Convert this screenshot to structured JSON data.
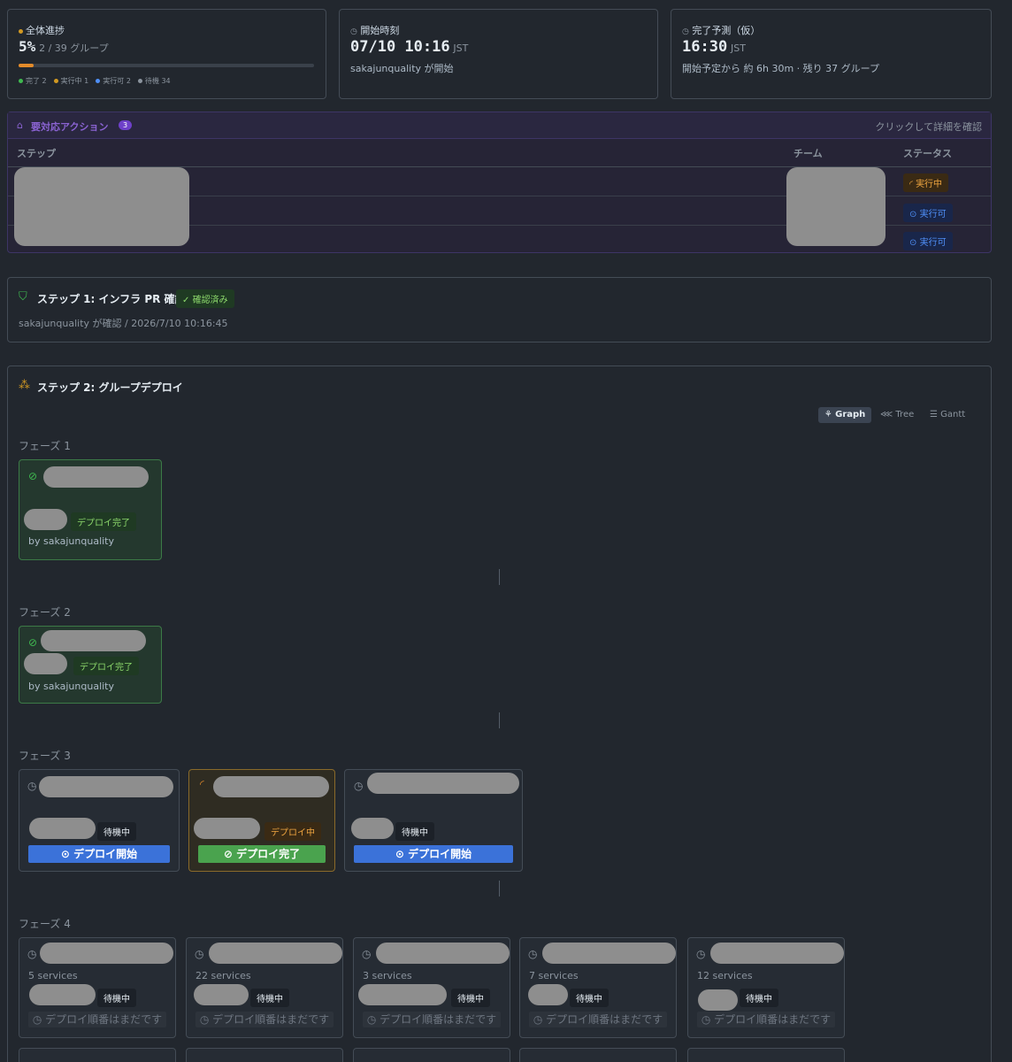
{
  "summary": {
    "progress": {
      "label": "全体進捗",
      "percent": "5%",
      "detail": "2 / 39 グループ",
      "fraction": 0.05,
      "legend": [
        {
          "label": "完了 2",
          "color": "#3fb950"
        },
        {
          "label": "実行中 1",
          "color": "#d29922"
        },
        {
          "label": "実行可 2",
          "color": "#4f8ff7"
        },
        {
          "label": "待機 34",
          "color": "#8b949e"
        }
      ]
    },
    "start": {
      "label": "開始時刻",
      "time": "07/10 10:16",
      "tz": "JST",
      "detail": "sakajunquality が開始"
    },
    "eta": {
      "label": "完了予測（仮）",
      "time": "16:30",
      "tz": "JST",
      "detail": "開始予定から 約 6h 30m · 残り 37 グループ"
    }
  },
  "actions": {
    "title": "要対応アクション",
    "count": "3",
    "hint": "クリックして詳細を確認",
    "columns": [
      "ステップ",
      "チーム",
      "ステータス"
    ],
    "rows": [
      {
        "status": "実行中"
      },
      {
        "status": "実行可"
      },
      {
        "status": "実行可"
      }
    ]
  },
  "step1": {
    "title": "ステップ 1: インフラ PR 確認",
    "badge": "確認済み",
    "detail": "sakajunquality が確認 / 2026/7/10 10:16:45"
  },
  "step2": {
    "title": "ステップ 2: グループデプロイ",
    "views": [
      "Graph",
      "Tree",
      "Gantt"
    ],
    "phases": [
      {
        "label": "フェーズ 1",
        "cards": [
          {
            "status": "デプロイ完了",
            "by": "by sakajunquality"
          }
        ]
      },
      {
        "label": "フェーズ 2",
        "cards": [
          {
            "status": "デプロイ完了",
            "by": "by sakajunquality"
          }
        ]
      },
      {
        "label": "フェーズ 3",
        "cards": [
          {
            "status": "待機中",
            "button": "デプロイ開始"
          },
          {
            "status": "デプロイ中",
            "button": "デプロイ完了"
          },
          {
            "status": "待機中",
            "button": "デプロイ開始"
          }
        ]
      },
      {
        "label": "フェーズ 4",
        "cards": [
          {
            "services": "5 services",
            "status": "待機中",
            "button": "デプロイ順番はまだです"
          },
          {
            "services": "22 services",
            "status": "待機中",
            "button": "デプロイ順番はまだです"
          },
          {
            "services": "3 services",
            "status": "待機中",
            "button": "デプロイ順番はまだです"
          },
          {
            "services": "7 services",
            "status": "待機中",
            "button": "デプロイ順番はまだです"
          },
          {
            "services": "12 services",
            "status": "待機中",
            "button": "デプロイ順番はまだです"
          }
        ]
      }
    ]
  }
}
